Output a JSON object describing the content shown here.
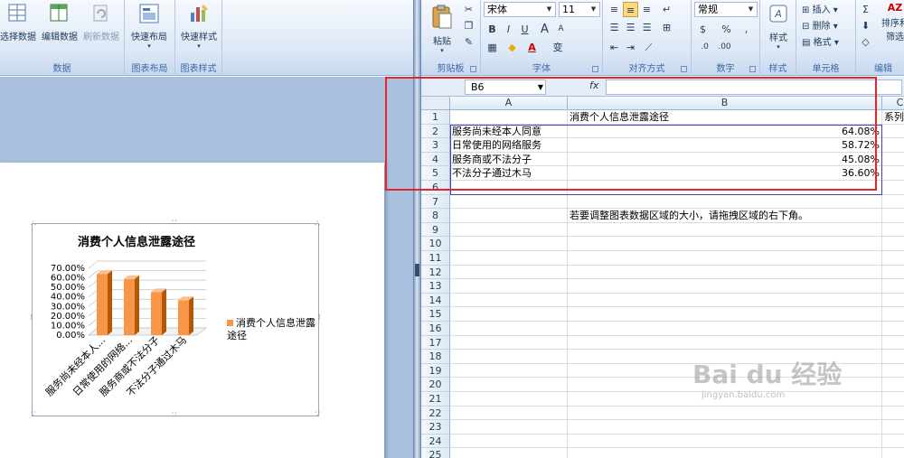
{
  "word": {
    "ribbon": {
      "groups": [
        {
          "label": "数据",
          "buttons": [
            "选择数据",
            "编辑数据",
            "刷新数据"
          ]
        },
        {
          "label": "图表布局",
          "buttons": [
            "快速布局"
          ]
        },
        {
          "label": "图表样式",
          "buttons": [
            "快速样式"
          ]
        }
      ]
    },
    "chart": {
      "legend_label": "消费个人信息泄露途径"
    }
  },
  "excel": {
    "ribbon": {
      "clipboard": {
        "label": "剪贴板",
        "paste": "粘贴"
      },
      "font": {
        "label": "字体",
        "font_name": "宋体",
        "font_size": "11",
        "bold": "B",
        "italic": "I",
        "underline": "U",
        "font_color": "A",
        "wen": "变"
      },
      "alignment": {
        "label": "对齐方式"
      },
      "number": {
        "label": "数字",
        "format": "常规",
        "percent": "%"
      },
      "styles": {
        "label": "样式",
        "button": "样式"
      },
      "cells": {
        "label": "单元格",
        "insert": "插入",
        "delete": "删除",
        "format": "格式"
      },
      "editing": {
        "label": "编辑",
        "sort": "排序和",
        "filter": "筛选"
      }
    },
    "formula_bar": {
      "name_box": "B6",
      "fx": "fx",
      "value": ""
    },
    "columns": [
      "A",
      "B",
      "C"
    ],
    "rows": [
      "1",
      "2",
      "3",
      "4",
      "5",
      "6",
      "7",
      "8",
      "9",
      "10",
      "11",
      "12",
      "13",
      "14",
      "15",
      "16",
      "17",
      "18",
      "19",
      "20",
      "21",
      "22",
      "23",
      "24",
      "25"
    ],
    "cells": {
      "B1": "消费个人信息泄露途径",
      "C1": "系列",
      "A2": "服务尚未经本人同意",
      "B2": "64.08%",
      "A3": "日常使用的网络服务",
      "B3": "58.72%",
      "A4": "服务商或不法分子",
      "B4": "45.08%",
      "A5": "不法分子通过木马",
      "B5": "36.60%",
      "B8": "若要调整图表数据区域的大小，请拖拽区域的右下角。"
    }
  },
  "watermark": {
    "main": "Bai du 经验",
    "sub": "jingyan.baidu.com"
  },
  "chart_data": {
    "type": "bar",
    "title": "消费个人信息泄露途径",
    "categories": [
      "服务尚未经本人...",
      "日常使用的网络...",
      "服务商或不法分子",
      "不法分子通过木马"
    ],
    "series": [
      {
        "name": "消费个人信息泄露途径",
        "values": [
          64.08,
          58.72,
          45.08,
          36.6
        ]
      }
    ],
    "ylim": [
      0,
      70
    ],
    "yticks": [
      "0.00%",
      "10.00%",
      "20.00%",
      "30.00%",
      "40.00%",
      "50.00%",
      "60.00%",
      "70.00%"
    ],
    "color": "#f79646",
    "grid": true,
    "legend": "right"
  }
}
